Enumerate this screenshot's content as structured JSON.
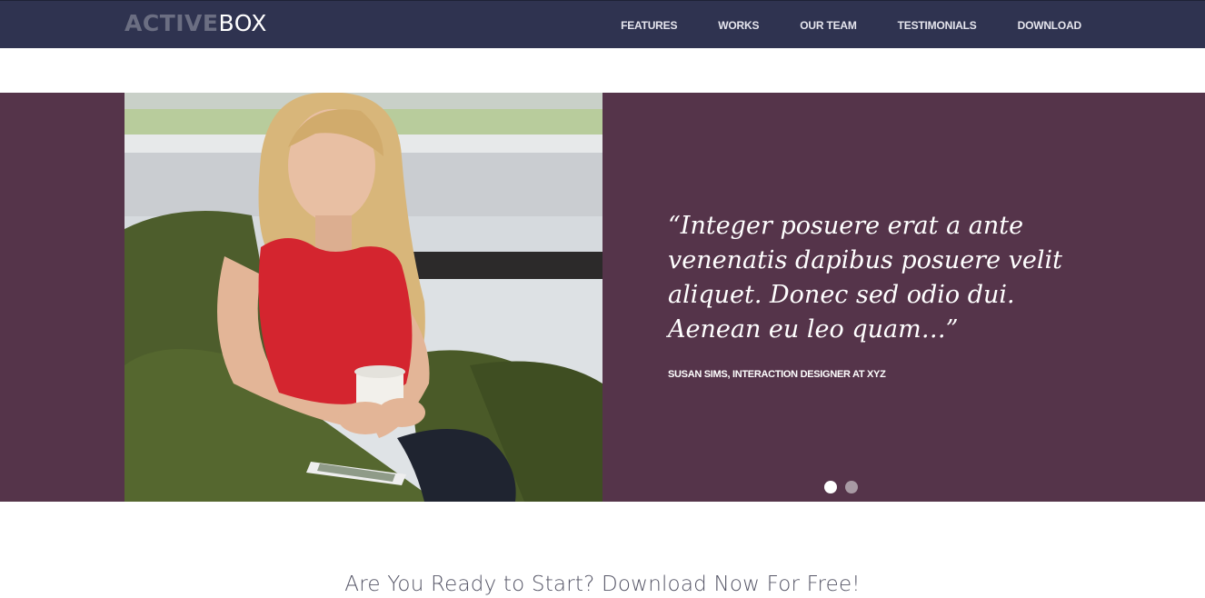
{
  "brand": {
    "part1": "ACTIVE",
    "part2": "BOX"
  },
  "nav": {
    "items": [
      {
        "label": "FEATURES"
      },
      {
        "label": "WORKS"
      },
      {
        "label": "OUR TEAM"
      },
      {
        "label": "TESTIMONIALS"
      },
      {
        "label": "DOWNLOAD"
      }
    ]
  },
  "testimonial": {
    "quote": "“Integer posuere erat a ante venenatis dapibus posuere velit aliquet. Donec sed odio dui. Aenean eu leo quam…”",
    "author": "SUSAN SIMS, INTERACTION DESIGNER AT XYZ",
    "slides": {
      "count": 2,
      "active_index": 0
    }
  },
  "cta": {
    "text": "Are You Ready to Start? Download Now For Free!"
  },
  "colors": {
    "navbar": "#2f3350",
    "testimonial_bg": "#55344a",
    "accent_red": "#d4252f",
    "chair_green": "#4a5a2a"
  },
  "icons": [
    "slide-dot"
  ]
}
